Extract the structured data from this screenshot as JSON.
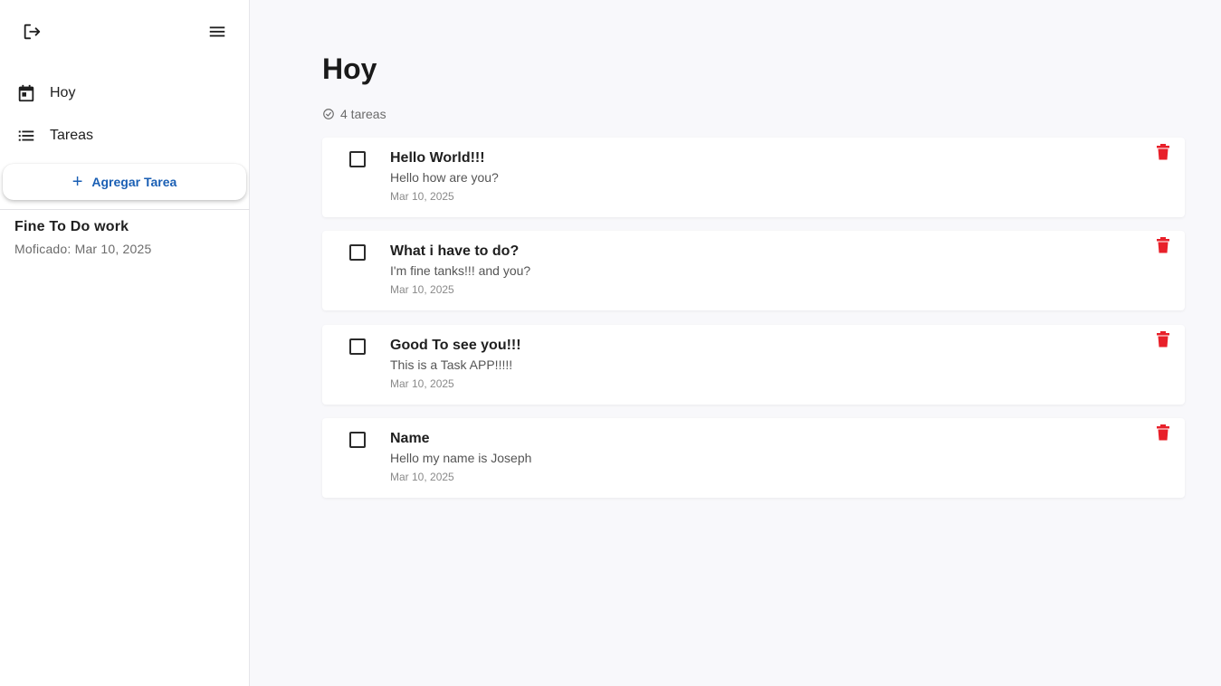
{
  "sidebar": {
    "nav": [
      {
        "label": "Hoy",
        "icon": "calendar-today-icon"
      },
      {
        "label": "Tareas",
        "icon": "list-icon"
      }
    ],
    "add_button": {
      "plus": "+",
      "label": "Agregar Tarea"
    },
    "lists": [
      {
        "title": "Fine To Do work",
        "meta": "Moficado: Mar 10, 2025"
      }
    ]
  },
  "main": {
    "title": "Hoy",
    "count": "4 tareas",
    "tasks": [
      {
        "title": "Hello World!!!",
        "description": "Hello how are you?",
        "date": "Mar 10, 2025",
        "done": false
      },
      {
        "title": "What i have to do?",
        "description": "I'm fine tanks!!! and you?",
        "date": "Mar 10, 2025",
        "done": false
      },
      {
        "title": "Good To see you!!!",
        "description": "This is a Task APP!!!!!",
        "date": "Mar 10, 2025",
        "done": false
      },
      {
        "title": "Name",
        "description": "Hello my name is Joseph",
        "date": "Mar 10, 2025",
        "done": false
      }
    ]
  },
  "colors": {
    "accent": "#1a5fb4",
    "delete": "#e8202a",
    "background": "#f8f8fb"
  }
}
